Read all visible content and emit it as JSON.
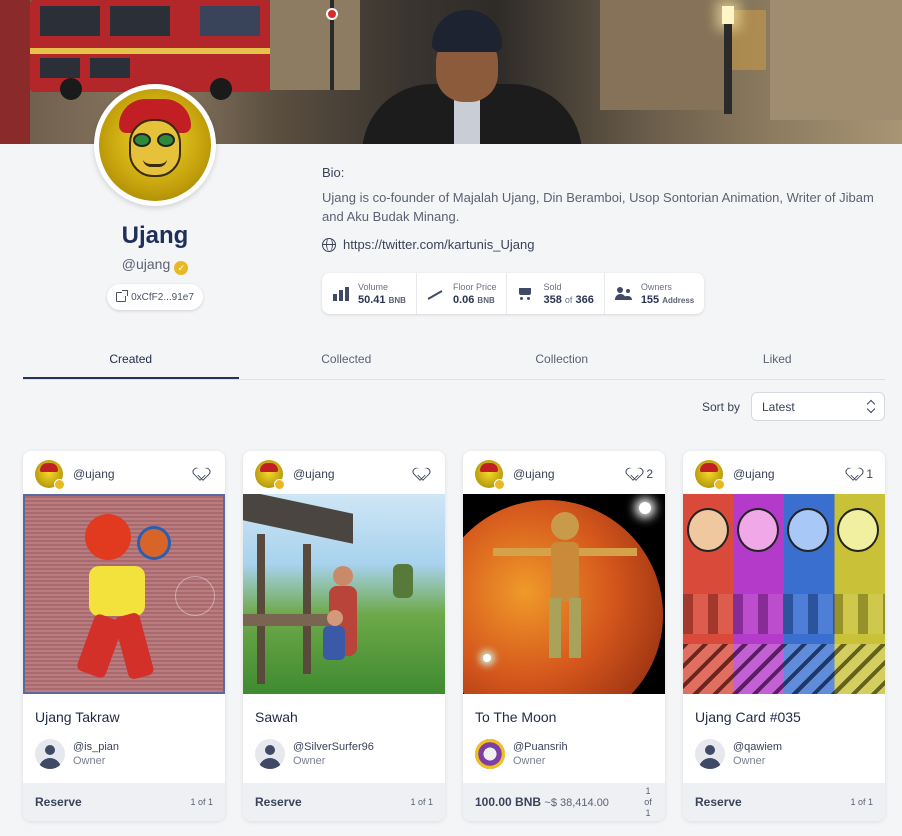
{
  "profile": {
    "name": "Ujang",
    "handle": "@ujang",
    "wallet": "0xCfF2...91e7",
    "bio_label": "Bio:",
    "bio": "Ujang is co-founder of Majalah Ujang, Din Beramboi, Usop Sontorian Animation, Writer of Jibam and Aku Budak Minang.",
    "link": "https://twitter.com/kartunis_Ujang"
  },
  "stats": {
    "volume": {
      "label": "Volume",
      "value": "50.41",
      "unit": "BNB"
    },
    "floor": {
      "label": "Floor Price",
      "value": "0.06",
      "unit": "BNB"
    },
    "sold": {
      "label": "Sold",
      "sold": "358",
      "of": "of",
      "total": "366"
    },
    "owners": {
      "label": "Owners",
      "value": "155",
      "unit": "Address"
    }
  },
  "tabs": [
    "Created",
    "Collected",
    "Collection",
    "Liked"
  ],
  "sort": {
    "label": "Sort by",
    "value": "Latest"
  },
  "cards": [
    {
      "creator": "@ujang",
      "likes": "",
      "title": "Ujang Takraw",
      "owner": "@is_pian",
      "role": "Owner",
      "price": "Reserve",
      "usd": "",
      "edition": "1 of 1"
    },
    {
      "creator": "@ujang",
      "likes": "",
      "title": "Sawah",
      "owner": "@SilverSurfer96",
      "role": "Owner",
      "price": "Reserve",
      "usd": "",
      "edition": "1 of 1"
    },
    {
      "creator": "@ujang",
      "likes": "2",
      "title": "To The Moon",
      "owner": "@Puansrih",
      "role": "Owner",
      "price": "100.00 BNB",
      "usd": "~$ 38,414.00",
      "edition": "1 of 1"
    },
    {
      "creator": "@ujang",
      "likes": "1",
      "title": "Ujang Card #035",
      "owner": "@qawiem",
      "role": "Owner",
      "price": "Reserve",
      "usd": "",
      "edition": "1 of 1"
    }
  ]
}
